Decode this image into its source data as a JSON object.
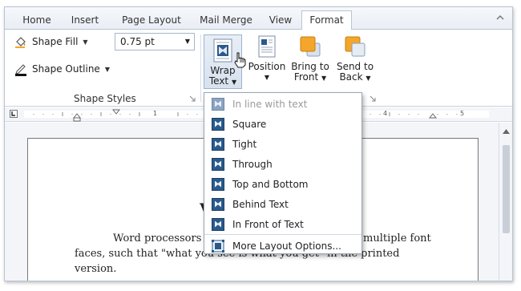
{
  "tabs": [
    {
      "label": "Home",
      "active": false
    },
    {
      "label": "Insert",
      "active": false
    },
    {
      "label": "Page Layout",
      "active": false
    },
    {
      "label": "Mail Merge",
      "active": false
    },
    {
      "label": "View",
      "active": false
    },
    {
      "label": "Format",
      "active": true
    }
  ],
  "ribbon": {
    "shape_fill_label": "Shape Fill",
    "shape_outline_label": "Shape Outline",
    "outline_width_value": "0.75 pt",
    "group_label": "Shape Styles",
    "wrap_text_line1": "Wrap",
    "wrap_text_line2": "Text",
    "position_label": "Position",
    "bring_line1": "Bring to",
    "bring_line2": "Front",
    "send_line1": "Send to",
    "send_line2": "Back"
  },
  "ruler": {
    "marks": [
      "1",
      "4",
      "5"
    ]
  },
  "document": {
    "heading_fragment": "V",
    "line1_left": "Word processors",
    "line1_right": "multiple font",
    "line2_left": "faces, such that \"what you see is what you get\" in the printed",
    "line3": "version."
  },
  "wrap_menu": {
    "items": [
      {
        "label": "In line with text",
        "disabled": true,
        "icon": "wrap-inline-icon"
      },
      {
        "label": "Square",
        "disabled": false,
        "icon": "wrap-square-icon"
      },
      {
        "label": "Tight",
        "disabled": false,
        "icon": "wrap-tight-icon"
      },
      {
        "label": "Through",
        "disabled": false,
        "icon": "wrap-through-icon"
      },
      {
        "label": "Top and Bottom",
        "disabled": false,
        "icon": "wrap-top-bottom-icon"
      },
      {
        "label": "Behind Text",
        "disabled": false,
        "icon": "wrap-behind-icon"
      },
      {
        "label": "In Front of Text",
        "disabled": false,
        "icon": "wrap-front-icon"
      }
    ],
    "more_label": "More Layout Options..."
  },
  "colors": {
    "accent": "#2a5a8a",
    "orange": "#f4a62a",
    "border": "#b9c5d4"
  }
}
